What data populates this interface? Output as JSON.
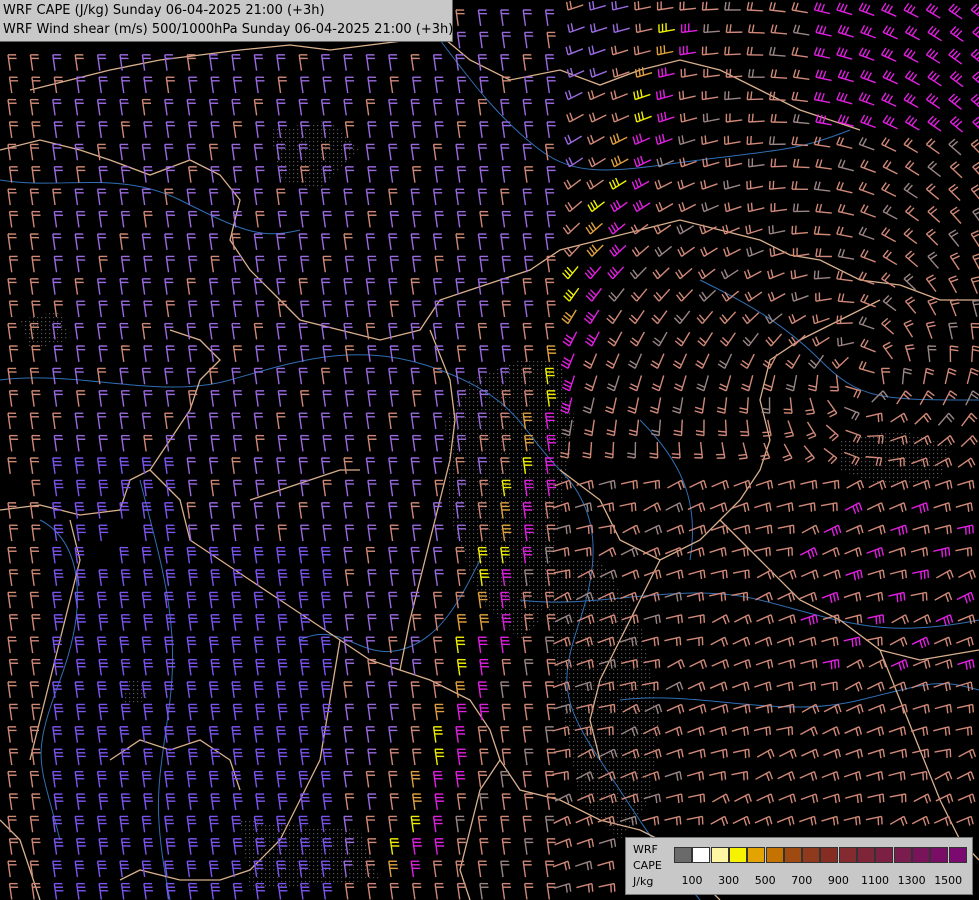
{
  "header": {
    "title_line1": "WRF CAPE (J/kg) Sunday 06-04-2025 21:00 (+3h)",
    "title_line2": "WRF Wind shear (m/s) 500/1000hPa Sunday 06-04-2025 21:00 (+3h)"
  },
  "legend": {
    "model_label": "WRF",
    "variable_label": "CAPE",
    "unit_label": "J/kg",
    "swatches": [
      {
        "color": "#6a6a6a"
      },
      {
        "color": "#ffffff"
      },
      {
        "color": "#fdf7a4"
      },
      {
        "color": "#f6f200"
      },
      {
        "color": "#e3a300"
      },
      {
        "color": "#c47200"
      },
      {
        "color": "#9e4a10"
      },
      {
        "color": "#8f3a1c"
      },
      {
        "color": "#862d23"
      },
      {
        "color": "#832b30"
      },
      {
        "color": "#7f2539"
      },
      {
        "color": "#7b2043"
      },
      {
        "color": "#7b1c4f"
      },
      {
        "color": "#7a145a"
      },
      {
        "color": "#7a0e66"
      },
      {
        "color": "#7a0a70"
      }
    ],
    "ticks": [
      "100",
      "300",
      "500",
      "700",
      "900",
      "1100",
      "1300",
      "1500"
    ]
  },
  "colors": {
    "background": "#000000",
    "border_lines": "#d9b08c",
    "rivers": "#2f6fb5",
    "barb_tan": "#d08878",
    "barb_violet": "#9a6ae0",
    "barb_blue": "#7c55f0",
    "barb_yellow": "#f0f000",
    "barb_orange": "#e0a040",
    "barb_magenta": "#e020e0",
    "barb_gray": "#9a8585"
  }
}
